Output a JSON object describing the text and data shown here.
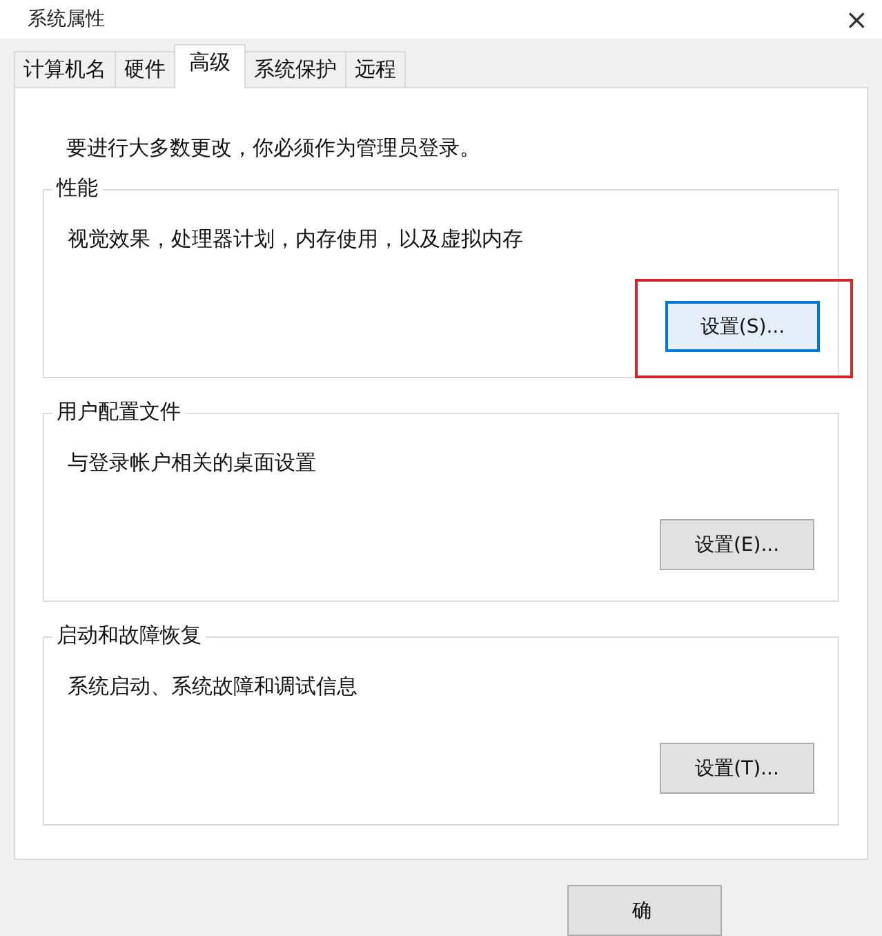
{
  "window": {
    "title": "系统属性",
    "close": "×"
  },
  "tabs": [
    {
      "label": "计算机名",
      "selected": false
    },
    {
      "label": "硬件",
      "selected": false
    },
    {
      "label": "高级",
      "selected": true
    },
    {
      "label": "系统保护",
      "selected": false
    },
    {
      "label": "远程",
      "selected": false
    }
  ],
  "notice": "要进行大多数更改，你必须作为管理员登录。",
  "groups": [
    {
      "title": "性能",
      "description": "视觉效果，处理器计划，内存使用，以及虚拟内存",
      "button": {
        "label": "设置(S)...",
        "focused": true,
        "highlighted": true
      }
    },
    {
      "title": "用户配置文件",
      "description": "与登录帐户相关的桌面设置",
      "button": {
        "label": "设置(E)...",
        "focused": false,
        "highlighted": false
      }
    },
    {
      "title": "启动和故障恢复",
      "description": "系统启动、系统故障和调试信息",
      "button": {
        "label": "设置(T)...",
        "focused": false,
        "highlighted": false
      }
    }
  ],
  "footer_button": "确"
}
